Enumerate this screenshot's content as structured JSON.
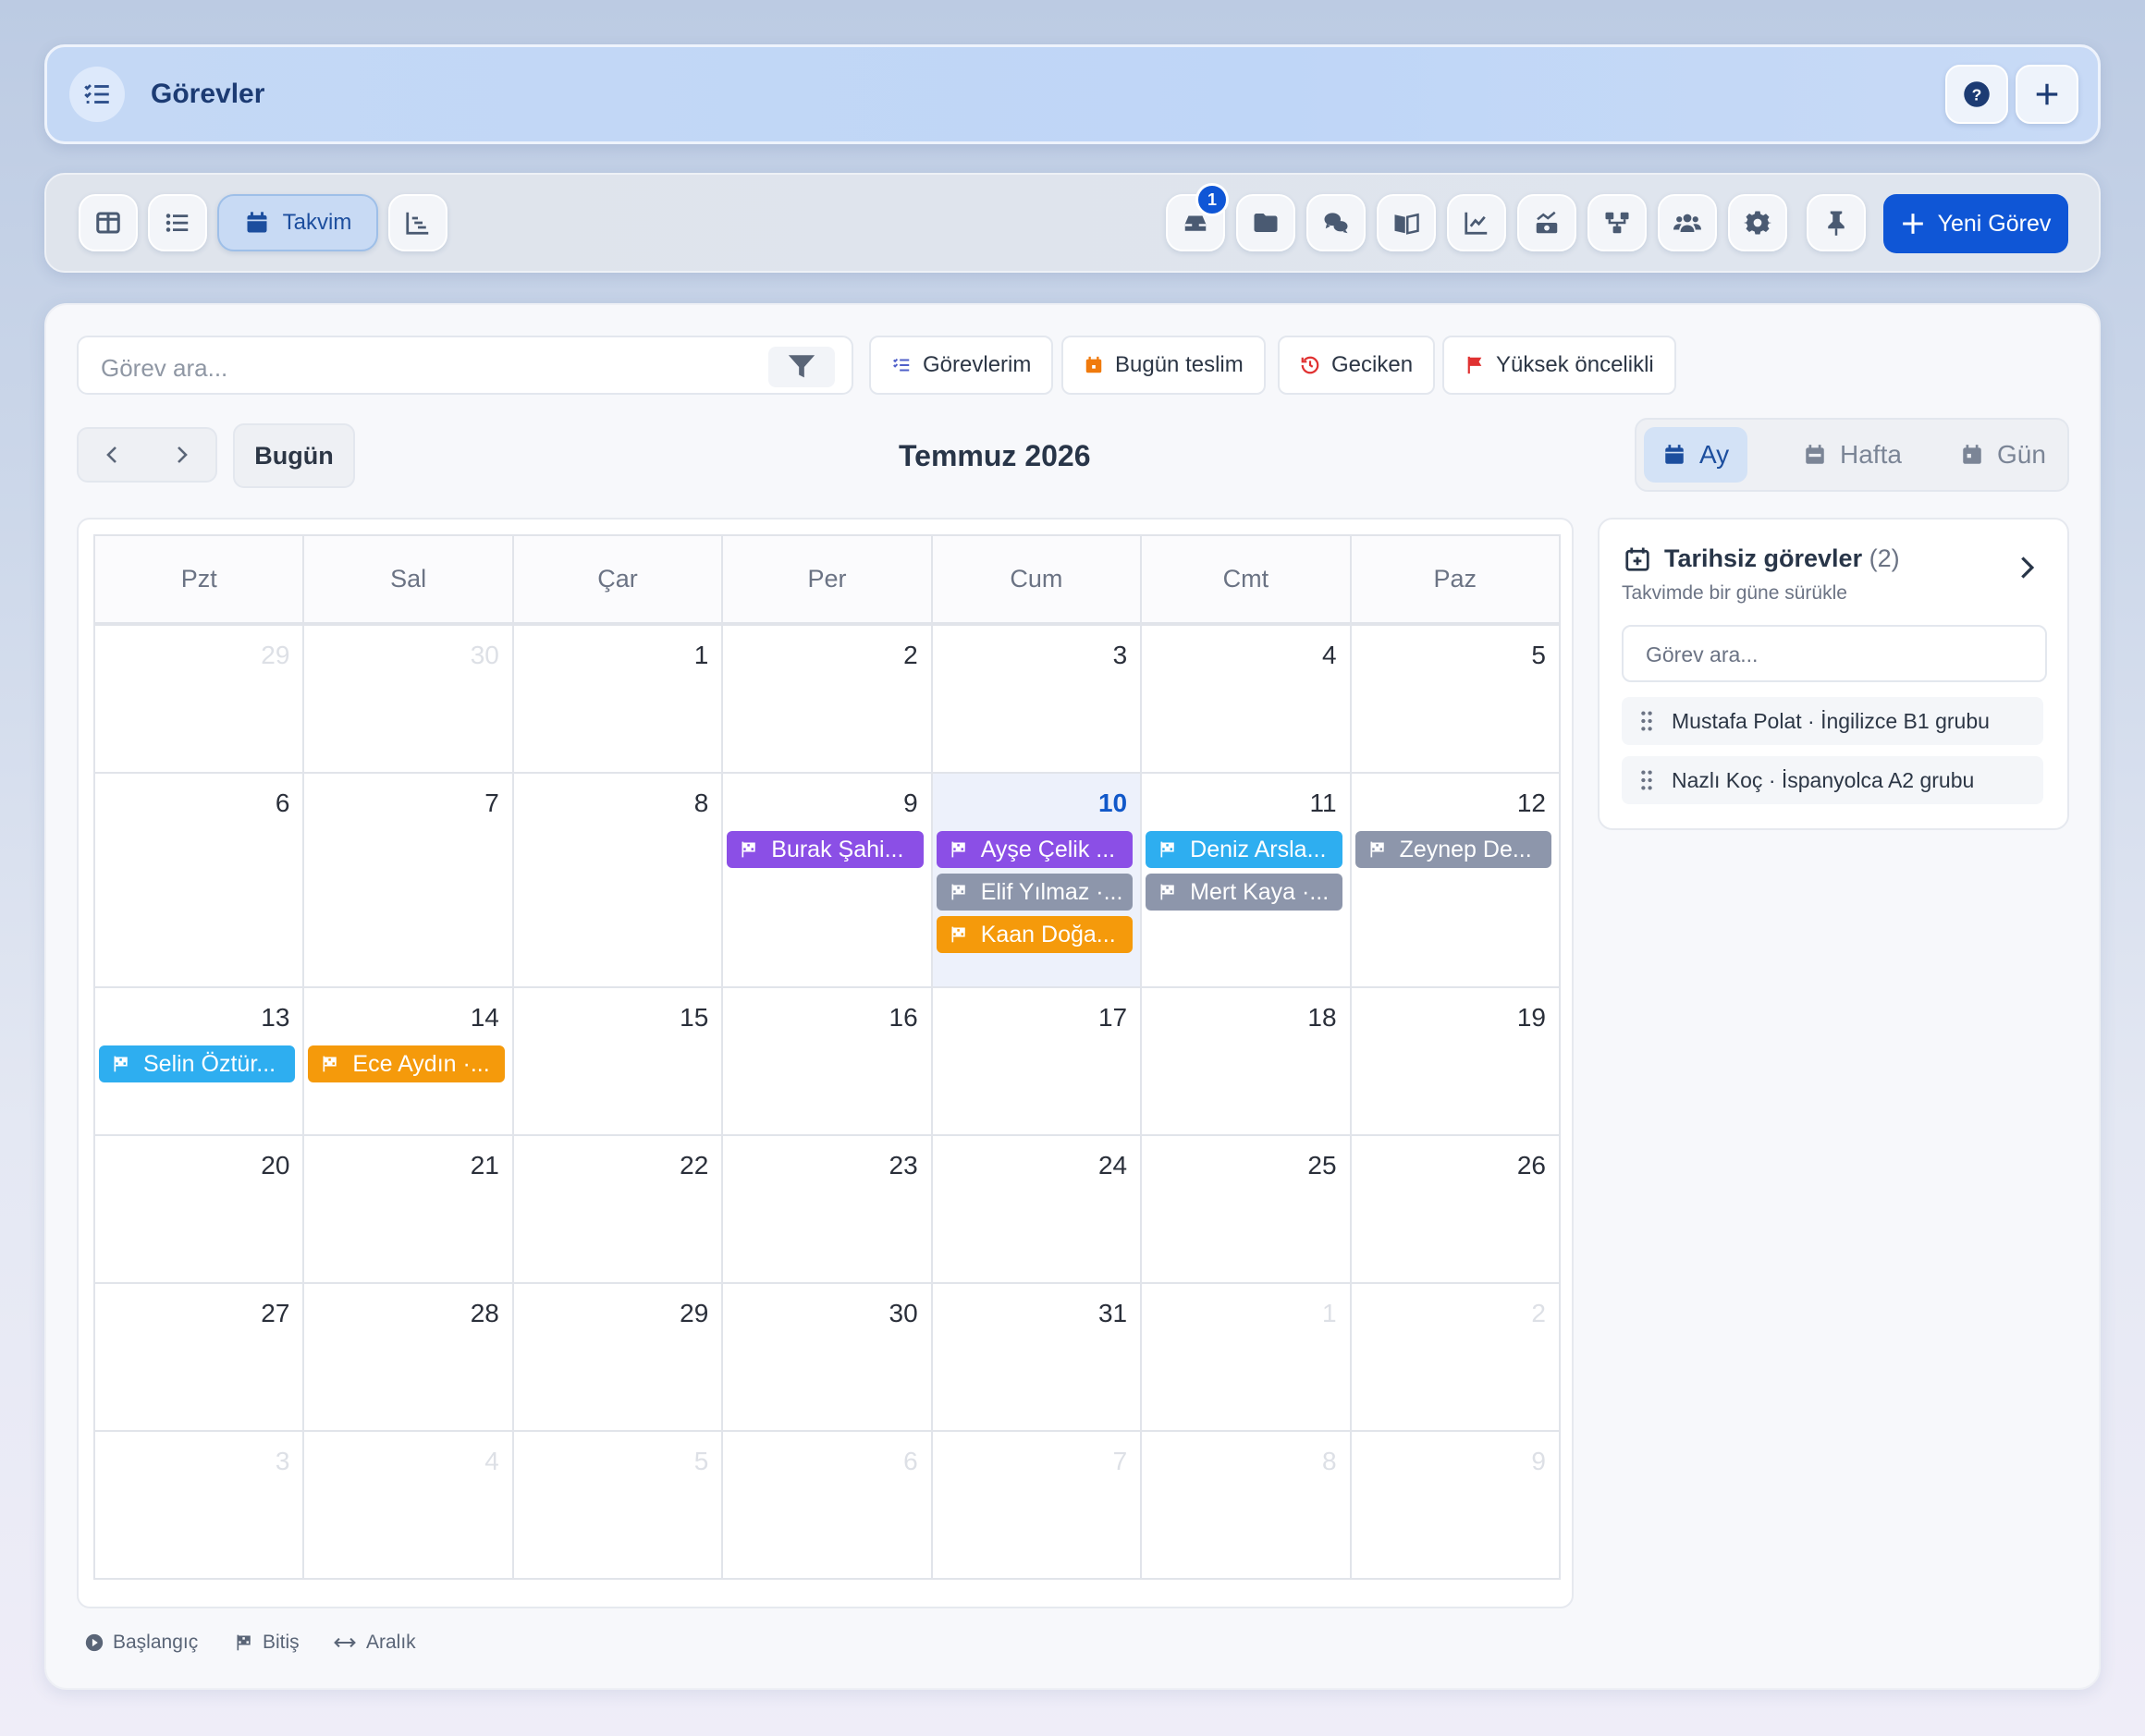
{
  "header": {
    "title": "Görevler",
    "help_icon": "question-circle-icon",
    "add_icon": "plus-icon"
  },
  "toolbar": {
    "calendar_label": "Takvim",
    "notification_count": "1",
    "new_task_label": "Yeni Görev"
  },
  "search": {
    "placeholder": "Görev ara..."
  },
  "chips": {
    "mine": "Görevlerim",
    "due_today": "Bugün teslim",
    "overdue": "Geciken",
    "high_priority": "Yüksek öncelikli"
  },
  "nav": {
    "today_label": "Bugün",
    "month_title": "Temmuz 2026"
  },
  "views": {
    "month": "Ay",
    "week": "Hafta",
    "day": "Gün"
  },
  "weekdays": [
    "Pzt",
    "Sal",
    "Çar",
    "Per",
    "Cum",
    "Cmt",
    "Paz"
  ],
  "weeks": [
    [
      {
        "d": "29",
        "o": true
      },
      {
        "d": "30",
        "o": true
      },
      {
        "d": "1"
      },
      {
        "d": "2"
      },
      {
        "d": "3"
      },
      {
        "d": "4"
      },
      {
        "d": "5"
      }
    ],
    [
      {
        "d": "6"
      },
      {
        "d": "7"
      },
      {
        "d": "8"
      },
      {
        "d": "9",
        "ev": [
          {
            "t": "Burak Şahi...",
            "c": "#8b4fe6"
          }
        ]
      },
      {
        "d": "10",
        "today": true,
        "ev": [
          {
            "t": "Ayşe Çelik ...",
            "c": "#8b4fe6"
          },
          {
            "t": "Elif Yılmaz ·...",
            "c": "#8d96ab"
          },
          {
            "t": "Kaan Doğa...",
            "c": "#f59a0b"
          }
        ]
      },
      {
        "d": "11",
        "ev": [
          {
            "t": "Deniz Arsla...",
            "c": "#2eaef0"
          },
          {
            "t": "Mert Kaya ·...",
            "c": "#8d96ab"
          }
        ]
      },
      {
        "d": "12",
        "ev": [
          {
            "t": "Zeynep De...",
            "c": "#8d96ab"
          }
        ]
      }
    ],
    [
      {
        "d": "13",
        "ev": [
          {
            "t": "Selin Öztür...",
            "c": "#2eaef0"
          }
        ]
      },
      {
        "d": "14",
        "ev": [
          {
            "t": "Ece Aydın ·...",
            "c": "#f59a0b"
          }
        ]
      },
      {
        "d": "15"
      },
      {
        "d": "16"
      },
      {
        "d": "17"
      },
      {
        "d": "18"
      },
      {
        "d": "19"
      }
    ],
    [
      {
        "d": "20"
      },
      {
        "d": "21"
      },
      {
        "d": "22"
      },
      {
        "d": "23"
      },
      {
        "d": "24"
      },
      {
        "d": "25"
      },
      {
        "d": "26"
      }
    ],
    [
      {
        "d": "27"
      },
      {
        "d": "28"
      },
      {
        "d": "29"
      },
      {
        "d": "30"
      },
      {
        "d": "31"
      },
      {
        "d": "1",
        "o": true
      },
      {
        "d": "2",
        "o": true
      }
    ],
    [
      {
        "d": "3",
        "o": true
      },
      {
        "d": "4",
        "o": true
      },
      {
        "d": "5",
        "o": true
      },
      {
        "d": "6",
        "o": true
      },
      {
        "d": "7",
        "o": true
      },
      {
        "d": "8",
        "o": true
      },
      {
        "d": "9",
        "o": true
      }
    ]
  ],
  "side": {
    "title": "Tarihsiz görevler",
    "count": "(2)",
    "subtitle": "Takvimde bir güne sürükle",
    "search_placeholder": "Görev ara...",
    "items": [
      "Mustafa Polat · İngilizce B1 grubu",
      "Nazlı Koç · İspanyolca A2 grubu"
    ]
  },
  "legend": {
    "start": "Başlangıç",
    "end": "Bitiş",
    "range": "Aralık"
  }
}
